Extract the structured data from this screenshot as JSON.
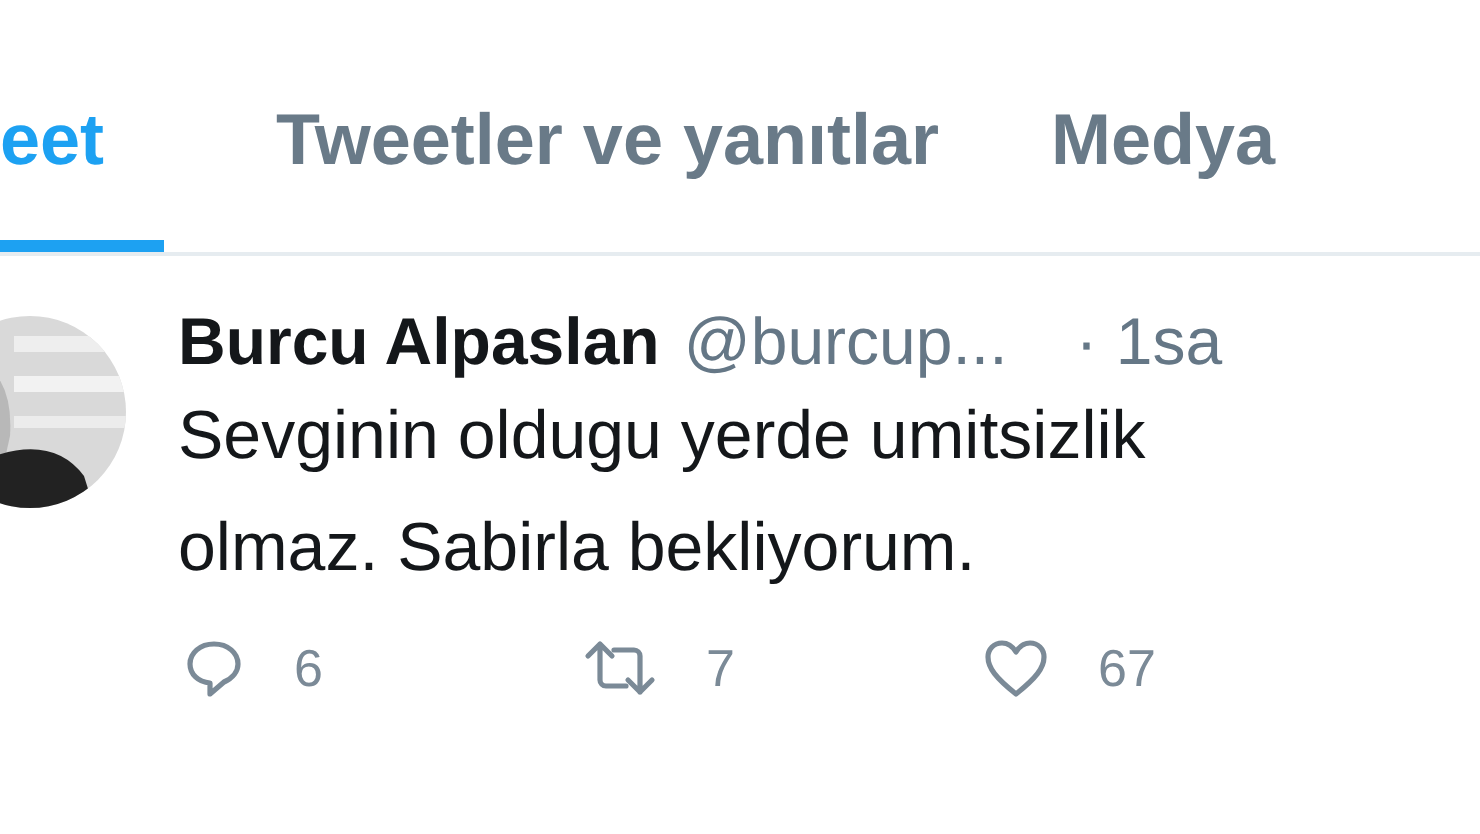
{
  "tabs": [
    {
      "label": "eet",
      "selected": true
    },
    {
      "label": "Tweetler ve yanıtlar",
      "selected": false
    },
    {
      "label": "Medya",
      "selected": false
    }
  ],
  "tweet": {
    "avatar": {
      "kind": "picture"
    },
    "name": "Burcu Alpaslan",
    "handle": "@burcup...",
    "time": "· 1sa",
    "lines": [
      "Sevginin oldugu yerde umitsizlik",
      "olmaz. Sabirla bekliyorum."
    ],
    "actions": [
      {
        "kind": "reply",
        "count": "6"
      },
      {
        "kind": "retweet",
        "count": "7"
      },
      {
        "kind": "like",
        "count": "67"
      }
    ]
  }
}
